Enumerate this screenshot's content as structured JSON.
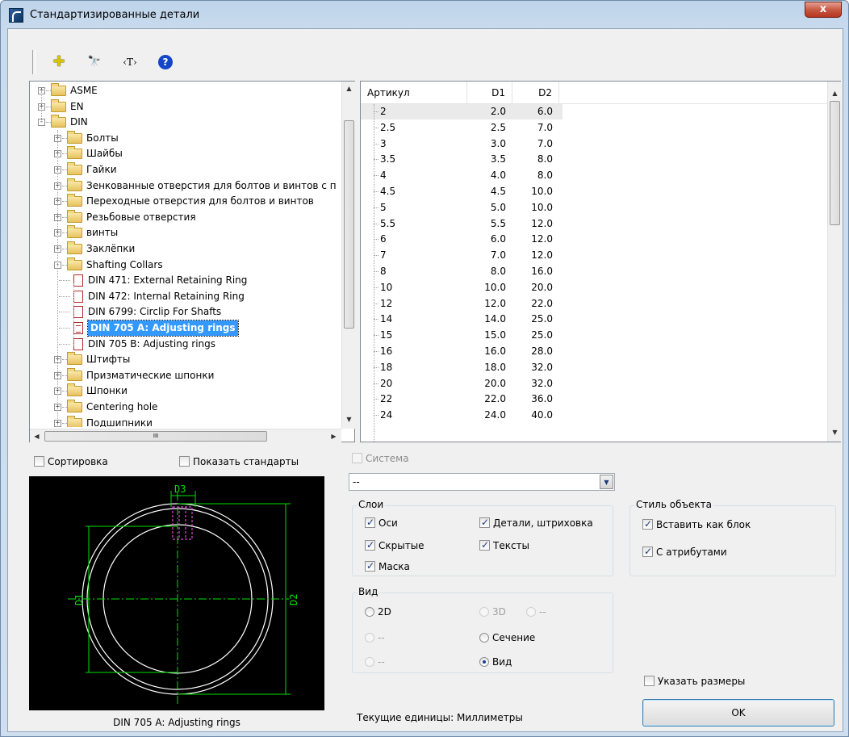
{
  "window": {
    "title": "Стандартизированные детали",
    "close_glyph": "x"
  },
  "toolbar": {
    "add_glyph": "✚",
    "find_glyph": "🔭",
    "text_glyph": "‹T›",
    "help_glyph": "?"
  },
  "tree": {
    "items": [
      {
        "label": "ASME",
        "type": "folder",
        "level": 0,
        "expander": "+"
      },
      {
        "label": "EN",
        "type": "folder",
        "level": 0,
        "expander": "+"
      },
      {
        "label": "DIN",
        "type": "folder",
        "level": 0,
        "expander": "-"
      },
      {
        "label": "Болты",
        "type": "folder",
        "level": 1,
        "expander": "+"
      },
      {
        "label": "Шайбы",
        "type": "folder",
        "level": 1,
        "expander": "+"
      },
      {
        "label": "Гайки",
        "type": "folder",
        "level": 1,
        "expander": "+"
      },
      {
        "label": "Зенкованные отверстия для болтов и винтов с п",
        "type": "folder",
        "level": 1,
        "expander": "+"
      },
      {
        "label": "Переходные отверстия для болтов и винтов",
        "type": "folder",
        "level": 1,
        "expander": "+"
      },
      {
        "label": "Резьбовые отверстия",
        "type": "folder",
        "level": 1,
        "expander": "+"
      },
      {
        "label": "винты",
        "type": "folder",
        "level": 1,
        "expander": "+"
      },
      {
        "label": "Заклёпки",
        "type": "folder",
        "level": 1,
        "expander": "+"
      },
      {
        "label": "Shafting Collars",
        "type": "folder",
        "level": 1,
        "expander": "-"
      },
      {
        "label": "DIN 471: External Retaining Ring",
        "type": "doc",
        "level": 2
      },
      {
        "label": "DIN 472: Internal Retaining Ring",
        "type": "doc",
        "level": 2
      },
      {
        "label": "DIN 6799: Circlip For Shafts",
        "type": "doc",
        "level": 2
      },
      {
        "label": "DIN 705 A: Adjusting rings",
        "type": "doc",
        "level": 2,
        "selected": true
      },
      {
        "label": "DIN 705 B: Adjusting rings",
        "type": "doc",
        "level": 2
      },
      {
        "label": "Штифты",
        "type": "folder",
        "level": 1,
        "expander": "+"
      },
      {
        "label": "Призматические шпонки",
        "type": "folder",
        "level": 1,
        "expander": "+"
      },
      {
        "label": "Шпонки",
        "type": "folder",
        "level": 1,
        "expander": "+"
      },
      {
        "label": "Centering hole",
        "type": "folder",
        "level": 1,
        "expander": "+"
      },
      {
        "label": "Подшипники",
        "type": "folder",
        "level": 1,
        "expander": "+"
      }
    ],
    "hscroll_grip": "III"
  },
  "table": {
    "columns": [
      "Артикул",
      "D1",
      "D2"
    ],
    "rows": [
      [
        "2",
        "2.0",
        "6.0"
      ],
      [
        "2.5",
        "2.5",
        "7.0"
      ],
      [
        "3",
        "3.0",
        "7.0"
      ],
      [
        "3.5",
        "3.5",
        "8.0"
      ],
      [
        "4",
        "4.0",
        "8.0"
      ],
      [
        "4.5",
        "4.5",
        "10.0"
      ],
      [
        "5",
        "5.0",
        "10.0"
      ],
      [
        "5.5",
        "5.5",
        "12.0"
      ],
      [
        "6",
        "6.0",
        "12.0"
      ],
      [
        "7",
        "7.0",
        "12.0"
      ],
      [
        "8",
        "8.0",
        "16.0"
      ],
      [
        "10",
        "10.0",
        "20.0"
      ],
      [
        "12",
        "12.0",
        "22.0"
      ],
      [
        "14",
        "14.0",
        "25.0"
      ],
      [
        "15",
        "15.0",
        "25.0"
      ],
      [
        "16",
        "16.0",
        "28.0"
      ],
      [
        "18",
        "18.0",
        "32.0"
      ],
      [
        "20",
        "20.0",
        "32.0"
      ],
      [
        "22",
        "22.0",
        "36.0"
      ],
      [
        "24",
        "24.0",
        "40.0"
      ]
    ]
  },
  "options": {
    "sort": {
      "label": "Сортировка",
      "checked": false
    },
    "show_standards": {
      "label": "Показать стандарты",
      "checked": false
    },
    "system": {
      "label": "Система",
      "checked": false,
      "disabled": true
    }
  },
  "combo": {
    "value": "--"
  },
  "layers": {
    "title": "Слои",
    "axes": "Оси",
    "details": "Детали, штриховка",
    "hidden": "Скрытые",
    "texts": "Тексты",
    "mask": "Маска"
  },
  "object_style": {
    "title": "Стиль объекта",
    "insert_block": "Вставить как блок",
    "with_attrs": "С атрибутами"
  },
  "view": {
    "title": "Вид",
    "r2d": "2D",
    "r3d": "3D",
    "r3d_alt": "--",
    "r_left2": "--",
    "section": "Сечение",
    "r_left3": "--",
    "view": "Вид"
  },
  "preview": {
    "caption": "DIN 705 A: Adjusting rings",
    "d1": "D1",
    "d2": "D2",
    "d3": "D3"
  },
  "specify_sizes": "Указать размеры",
  "status": "Текущие единицы: Миллиметры",
  "ok": "OK",
  "colors": {
    "selection": "#3399ff",
    "preview_bg": "#000000",
    "dim_green": "#00e000",
    "hidden_magenta": "#ff55ff"
  }
}
